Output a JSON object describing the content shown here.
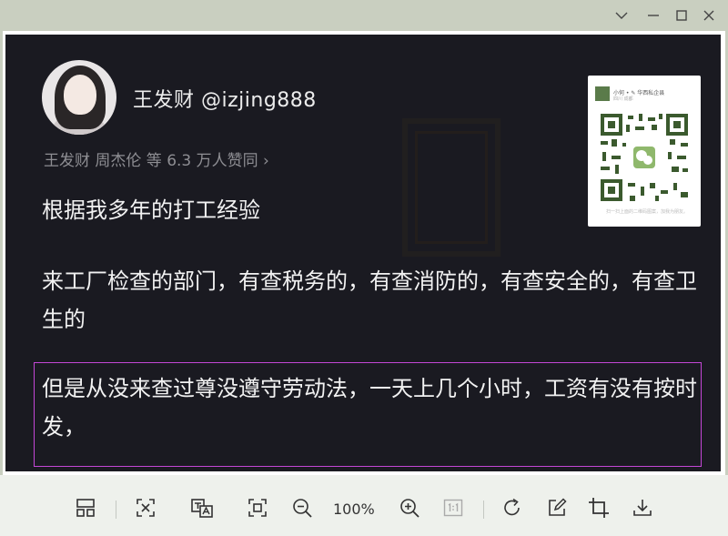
{
  "window": {
    "controls": [
      "chevron-down",
      "minimize",
      "maximize",
      "close"
    ]
  },
  "post": {
    "username": "王发财 @izjing888",
    "likes": "王发财 周杰伦 等 6.3 万人赞同 ›",
    "paragraphs": [
      "根据我多年的打工经验",
      "来工厂检查的部门，有查税务的，有查消防的，有查安全的，有查卫生的",
      "但是从没来查过尊没遵守劳动法，一天上几个小时，工资有没有按时发，"
    ],
    "highlight_color": "#c447d6",
    "qr": {
      "head_line1": "小何 • ✎ 华西私企县",
      "head_line2": "四川 成都",
      "foot": "扫一扫上面的二维码图案，加我为朋友。"
    }
  },
  "toolbar": {
    "zoom": "100%",
    "icons": [
      "layout-icon",
      "fit-screen-icon",
      "ocr-icon",
      "fullscreen-icon",
      "zoom-out-icon",
      "zoom-in-icon",
      "actual-size-icon",
      "rotate-icon",
      "edit-icon",
      "crop-icon",
      "download-icon"
    ]
  },
  "colors": {
    "canvas_bg": "#1a1a21",
    "chrome_bg": "#c9cfc0",
    "toolbar_bg": "#eef1ec"
  }
}
